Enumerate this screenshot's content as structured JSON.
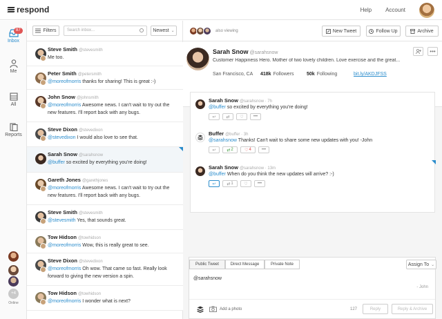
{
  "app": {
    "name": "respond"
  },
  "topnav": {
    "help": "Help",
    "account": "Account"
  },
  "rail": {
    "inbox_label": "Inbox",
    "inbox_count": "87",
    "me_label": "Me",
    "all_label": "All",
    "reports_label": "Reports",
    "online_count": "+4",
    "online_label": "Online"
  },
  "list_toolbar": {
    "filters": "Filters",
    "search_placeholder": "Search inbox...",
    "sort": "Newest"
  },
  "messages": [
    {
      "name": "Steve Smith",
      "handle": "@stevesmith",
      "mention": "",
      "text": "Me too."
    },
    {
      "name": "Peter Smith",
      "handle": "@petersmith",
      "mention": "@moreofmorris",
      "text": " thanks for sharing! This is great :-)"
    },
    {
      "name": "John Snow",
      "handle": "@johnsmith",
      "mention": "@moreofmorris",
      "text": " Awesome news. I can't wait to try out the new features. I'll report back with any bugs."
    },
    {
      "name": "Steve Dixon",
      "handle": "@stevedixon",
      "mention": "@stevedixon",
      "text": " I would also love to see that."
    },
    {
      "name": "Sarah Snow",
      "handle": "@sarahsnow",
      "mention": "@buffer",
      "text": " so excited by everything you're doing!"
    },
    {
      "name": "Gareth Jones",
      "handle": "@garethjones",
      "mention": "@moreofmorris",
      "text": " Awesome news. I can't wait to try out the new features. I'll report back with any bugs."
    },
    {
      "name": "Steve Smith",
      "handle": "@stevesmith",
      "mention": "@stevesmith",
      "text": " Yes, that sounds great."
    },
    {
      "name": "Tow Hidson",
      "handle": "@towhidson",
      "mention": "@moreofmorris",
      "text": " Wow, this is really great to see."
    },
    {
      "name": "Steve Dixon",
      "handle": "@stevedixon",
      "mention": "@moreofmorris",
      "text": " Oh wow. That came so fast. Really look forward to giving the new version a spin."
    },
    {
      "name": "Tow Hidson",
      "handle": "@towhidson",
      "mention": "@moreofmorris",
      "text": " I wonder what is next?"
    }
  ],
  "main_toolbar": {
    "also_viewing": "also viewing",
    "new_tweet": "New Tweet",
    "follow_up": "Follow Up",
    "archive": "Archive"
  },
  "profile": {
    "name": "Sarah Snow",
    "handle": "@sarahsnow",
    "bio": "Customer Happiness Hero. Mother of two lovely children. Love exercise and the great...",
    "location": "San Francisco, CA",
    "followers_count": "418k",
    "followers_label": "Followers",
    "following_count": "50k",
    "following_label": "Following",
    "link": "bit.ly/AKDJFSS"
  },
  "conversation": [
    {
      "name": "Sarah Snow",
      "meta": "@sarahsnow · 7h",
      "mention": "@buffer",
      "text": " so excited by everything you're doing!",
      "retweets": "",
      "likes": ""
    },
    {
      "name": "Buffer",
      "meta": "@buffer · 3h",
      "mention": "@sarahsnow",
      "text": " Thanks! Can't wait to share some new updates with you! -John",
      "retweets": "2",
      "likes": "4"
    },
    {
      "name": "Sarah Snow",
      "meta": "@sarahsnow · 13m",
      "mention": "@buffer",
      "text": " When do you think the new updates will arrive? :-)",
      "retweets": "1",
      "likes": ""
    }
  ],
  "compose": {
    "tab_public": "Public Tweet",
    "tab_direct": "Direct Message",
    "tab_private": "Private Note",
    "assign": "Assign To",
    "text": "@sarahsnow",
    "signature": "- John",
    "add_photo": "Add a photo",
    "char_count": "127",
    "reply": "Reply",
    "reply_archive": "Reply & Archive"
  },
  "colors": {
    "accent": "#2a8ccc",
    "badge": "#e05555",
    "retweet": "#3a9a3a",
    "like": "#dd4444"
  }
}
